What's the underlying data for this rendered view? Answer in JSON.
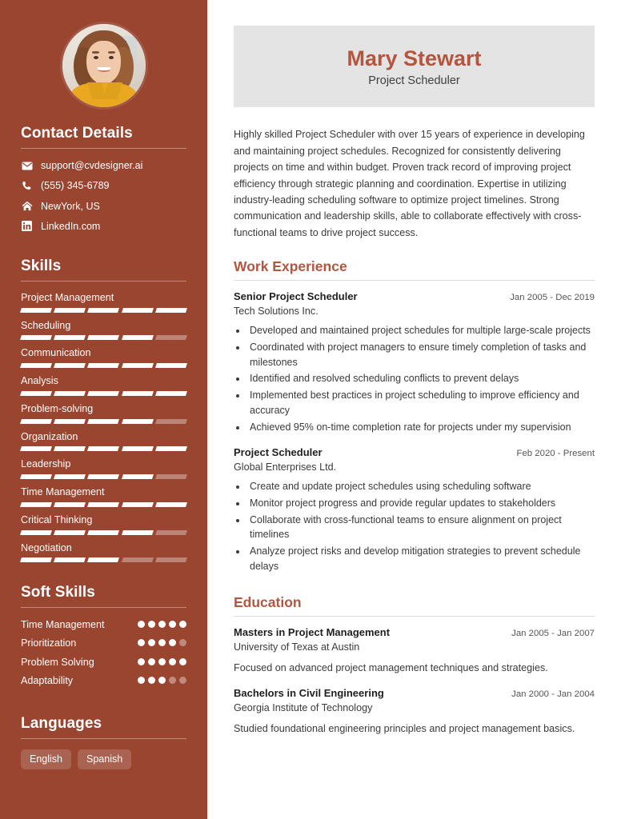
{
  "header": {
    "full_name": "Mary Stewart",
    "job_title": "Project Scheduler",
    "name_color": "#B5553E",
    "panel_color": "#e4e4e4"
  },
  "theme": {
    "sidebar_bg": "#9A4530",
    "accent": "#B5553E",
    "body_text": "#3a3a3a"
  },
  "sidebar": {
    "photo_alt": "profile-photo",
    "contact": {
      "heading": "Contact Details",
      "items": [
        {
          "icon": "envelope-icon",
          "label": "support@cvdesigner.ai"
        },
        {
          "icon": "phone-icon",
          "label": "(555) 345-6789"
        },
        {
          "icon": "home-icon",
          "label": "NewYork, US"
        },
        {
          "icon": "linkedin-icon",
          "label": "LinkedIn.com"
        }
      ]
    },
    "skills": {
      "heading": "Skills",
      "max": 5,
      "items": [
        {
          "name": "Project Management",
          "level": 5
        },
        {
          "name": "Scheduling",
          "level": 4
        },
        {
          "name": "Communication",
          "level": 5
        },
        {
          "name": "Analysis",
          "level": 5
        },
        {
          "name": "Problem-solving",
          "level": 4
        },
        {
          "name": "Organization",
          "level": 5
        },
        {
          "name": "Leadership",
          "level": 4
        },
        {
          "name": "Time Management",
          "level": 5
        },
        {
          "name": "Critical Thinking",
          "level": 4
        },
        {
          "name": "Negotiation",
          "level": 3
        }
      ]
    },
    "soft_skills": {
      "heading": "Soft Skills",
      "max": 5,
      "items": [
        {
          "name": "Time Management",
          "level": 5
        },
        {
          "name": "Prioritization",
          "level": 4
        },
        {
          "name": "Problem Solving",
          "level": 5
        },
        {
          "name": "Adaptability",
          "level": 3
        }
      ]
    },
    "languages": {
      "heading": "Languages",
      "items": [
        "English",
        "Spanish"
      ]
    }
  },
  "main": {
    "summary": "Highly skilled Project Scheduler with over 15 years of experience in developing and maintaining project schedules. Recognized for consistently delivering projects on time and within budget. Proven track record of improving project efficiency through strategic planning and coordination. Expertise in utilizing industry-leading scheduling software to optimize project timelines. Strong communication and leadership skills, able to collaborate effectively with cross-functional teams to drive project success.",
    "work": {
      "heading": "Work Experience",
      "entries": [
        {
          "title": "Senior Project Scheduler",
          "date": "Jan 2005 - Dec 2019",
          "org": "Tech Solutions Inc.",
          "bullets": [
            "Developed and maintained project schedules for multiple large-scale projects",
            "Coordinated with project managers to ensure timely completion of tasks and milestones",
            "Identified and resolved scheduling conflicts to prevent delays",
            "Implemented best practices in project scheduling to improve efficiency and accuracy",
            "Achieved 95% on-time completion rate for projects under my supervision"
          ]
        },
        {
          "title": "Project Scheduler",
          "date": "Feb 2020 - Present",
          "org": "Global Enterprises Ltd.",
          "bullets": [
            "Create and update project schedules using scheduling software",
            "Monitor project progress and provide regular updates to stakeholders",
            "Collaborate with cross-functional teams to ensure alignment on project timelines",
            "Analyze project risks and develop mitigation strategies to prevent schedule delays"
          ]
        }
      ]
    },
    "education": {
      "heading": "Education",
      "entries": [
        {
          "title": "Masters in Project Management",
          "date": "Jan 2005 - Jan 2007",
          "org": "University of Texas at Austin",
          "description": "Focused on advanced project management techniques and strategies."
        },
        {
          "title": "Bachelors in Civil Engineering",
          "date": "Jan 2000 - Jan 2004",
          "org": "Georgia Institute of Technology",
          "description": "Studied foundational engineering principles and project management basics."
        }
      ]
    }
  }
}
